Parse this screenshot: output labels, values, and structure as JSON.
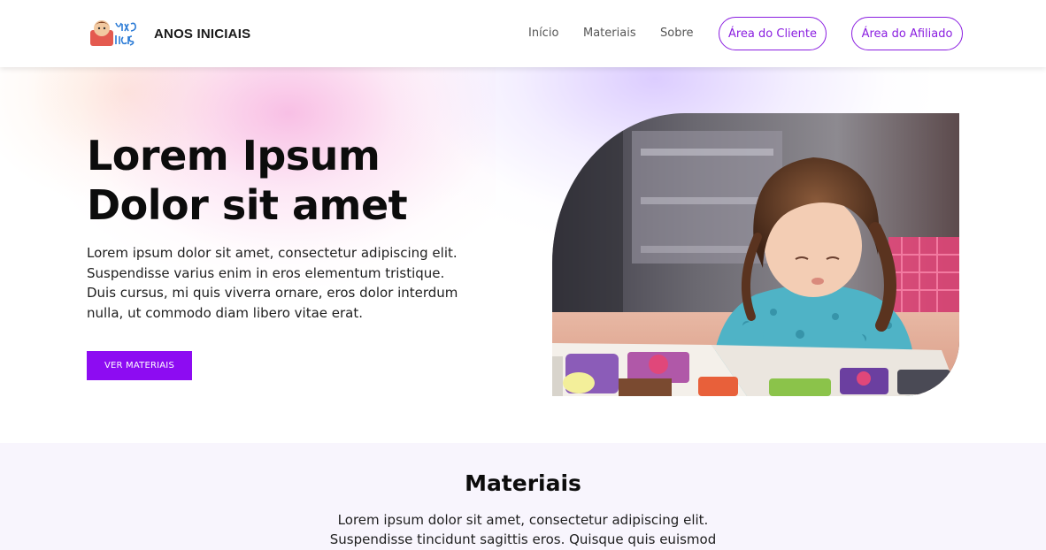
{
  "brand": {
    "name": "ANOS INICIAIS",
    "logo_icon": "anos-iniciais-logo"
  },
  "nav": {
    "links": [
      {
        "label": "Início"
      },
      {
        "label": "Materiais"
      },
      {
        "label": "Sobre"
      }
    ],
    "client_button": "Área do Cliente",
    "affiliate_button": "Área do Afiliado"
  },
  "hero": {
    "title_line1": "Lorem Ipsum",
    "title_line2": "Dolor sit amet",
    "text": "Lorem ipsum dolor sit amet, consectetur adipiscing elit. Suspendisse varius enim in eros elementum tristique. Duis cursus, mi quis viverra ornare, eros dolor interdum nulla, ut commodo diam libero vitae erat.",
    "cta": "VER MATERIAIS",
    "image": "toddler-playing-with-picture-book-photo"
  },
  "materiais": {
    "title": "Materiais",
    "text": "Lorem ipsum dolor sit amet, consectetur adipiscing elit. Suspendisse tincidunt sagittis eros. Quisque quis euismod"
  },
  "colors": {
    "accent": "#8d0cf2",
    "accent_border": "#8a1ee0",
    "section_bg": "#f8f5fd"
  }
}
